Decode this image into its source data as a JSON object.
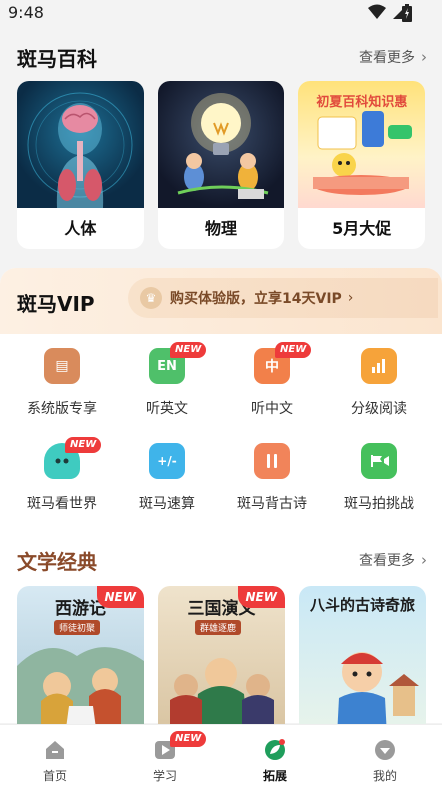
{
  "status_bar": {
    "time": "9:48"
  },
  "encyclopedia": {
    "title": "斑马百科",
    "more_label": "查看更多",
    "cards": [
      {
        "label": "人体"
      },
      {
        "label": "物理"
      },
      {
        "label": "5月大促",
        "banner_title": "初夏百科知识惠"
      }
    ]
  },
  "vip": {
    "title": "斑马VIP",
    "promo_text": "购买体验版，立享14天VIP",
    "items": [
      {
        "label": "系统版专享",
        "icon": "card-icon",
        "color": "#d98b5c",
        "glyph": "▤",
        "badge": ""
      },
      {
        "label": "听英文",
        "icon": "en-icon",
        "color": "#4fc06a",
        "glyph": "EN",
        "badge": "NEW"
      },
      {
        "label": "听中文",
        "icon": "zh-icon",
        "color": "#f2804a",
        "glyph": "中",
        "badge": "NEW"
      },
      {
        "label": "分级阅读",
        "icon": "book-chart-icon",
        "color": "#f6a33a",
        "glyph": "▮",
        "badge": ""
      },
      {
        "label": "斑马看世界",
        "icon": "ghost-icon",
        "color": "#3fcbc0",
        "glyph": "• •",
        "badge": "NEW"
      },
      {
        "label": "斑马速算",
        "icon": "calc-icon",
        "color": "#3fb4ea",
        "glyph": "+/-",
        "badge": ""
      },
      {
        "label": "斑马背古诗",
        "icon": "scroll-icon",
        "color": "#f1845a",
        "glyph": "❙❙",
        "badge": ""
      },
      {
        "label": "斑马拍挑战",
        "icon": "video-flag-icon",
        "color": "#45c05c",
        "glyph": "⚑",
        "badge": ""
      }
    ]
  },
  "literature": {
    "title": "文学经典",
    "more_label": "查看更多",
    "books": [
      {
        "title": "西游记",
        "subtitle": "师徒初聚",
        "tag": "NEW",
        "bg": "#cfe3ef"
      },
      {
        "title": "三国演义",
        "subtitle": "群雄逐鹿",
        "tag": "NEW",
        "bg": "#e9dcc4"
      },
      {
        "title": "八斗的古诗奇旅",
        "subtitle": "",
        "tag": "",
        "bg": "#bfe2f3"
      }
    ]
  },
  "tab_bar": {
    "tabs": [
      {
        "label": "首页",
        "icon": "home-icon"
      },
      {
        "label": "学习",
        "icon": "play-icon",
        "badge": "NEW"
      },
      {
        "label": "拓展",
        "icon": "leaf-icon",
        "active": true
      },
      {
        "label": "我的",
        "icon": "profile-icon"
      }
    ]
  }
}
